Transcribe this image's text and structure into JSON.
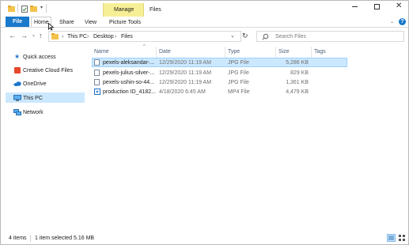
{
  "window": {
    "title": "Files"
  },
  "ribbon": {
    "manage_label": "Manage",
    "picture_tools_label": "Picture Tools",
    "tabs": [
      "File",
      "Home",
      "Share",
      "View"
    ]
  },
  "address": {
    "path": [
      "This PC",
      "Desktop",
      "Files"
    ],
    "search_placeholder": "Search Files"
  },
  "sidebar": {
    "items": [
      {
        "label": "Quick access",
        "icon": "star-icon"
      },
      {
        "label": "Creative Cloud Files",
        "icon": "creative-cloud-icon"
      },
      {
        "label": "OneDrive",
        "icon": "cloud-icon"
      },
      {
        "label": "This PC",
        "icon": "computer-icon",
        "selected": true
      },
      {
        "label": "Network",
        "icon": "network-icon"
      }
    ]
  },
  "columns": [
    "Name",
    "Date",
    "Type",
    "Size",
    "Tags"
  ],
  "files": [
    {
      "name": "pexels-aleksandar-...",
      "date": "12/29/2020 11:19 AM",
      "type": "JPG File",
      "size": "5,286 KB",
      "selected": true
    },
    {
      "name": "pexels-julius-silver-...",
      "date": "12/29/2020 11:19 AM",
      "type": "JPG File",
      "size": "829 KB"
    },
    {
      "name": "pexels-ushin-so-44...",
      "date": "12/29/2020 11:19 AM",
      "type": "JPG File",
      "size": "1,361 KB"
    },
    {
      "name": "production ID_4182...",
      "date": "4/18/2020 6:45 AM",
      "type": "MP4 File",
      "size": "4,479 KB"
    }
  ],
  "status": {
    "items_count": "4 items",
    "selection": "1 item selected  5.16 MB"
  },
  "colors": {
    "accent": "#1979ca",
    "selection": "#cce8ff",
    "manage_tab": "#f7ef96"
  }
}
